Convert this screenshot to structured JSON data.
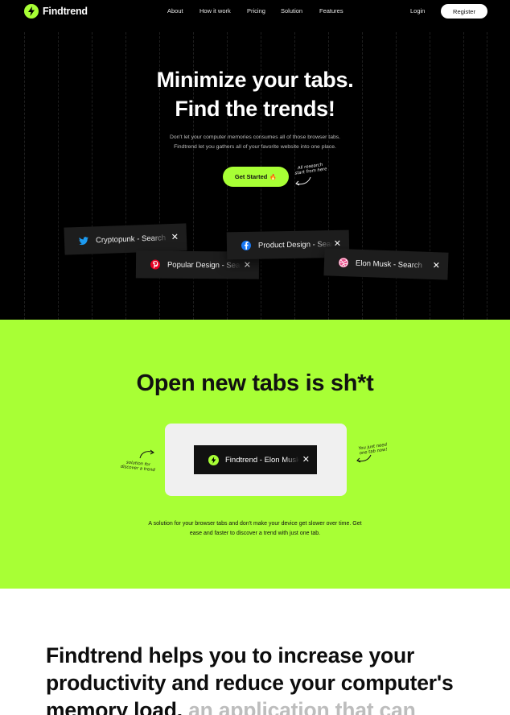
{
  "brand": {
    "name": "Findtrend",
    "accent": "#a8ff35"
  },
  "nav": {
    "links": [
      "About",
      "How it work",
      "Pricing",
      "Solution",
      "Features"
    ],
    "login": "Login",
    "register": "Register"
  },
  "hero": {
    "title_line1": "Minimize your tabs.",
    "title_line2": "Find the trends!",
    "subtitle_line1": "Don't let your computer memories consumes all of those browser tabs.",
    "subtitle_line2": "Findtrend  let you gathers all of your favorite website into one place.",
    "cta_label": "Get Started",
    "cta_emoji": "🔥",
    "note_line1": "All research",
    "note_line2": "start from here",
    "tabs": [
      {
        "icon": "twitter-icon",
        "color": "#1d9bf0",
        "title": "Cryptopunk - Search"
      },
      {
        "icon": "pinterest-icon",
        "color": "#e60023",
        "title": "Popular Design - Search"
      },
      {
        "icon": "facebook-icon",
        "color": "#1877f2",
        "title": "Product Design - Search"
      },
      {
        "icon": "dribbble-icon",
        "color": "#ea4c89",
        "title": "Elon Musk - Search"
      }
    ],
    "close_glyph": "✕"
  },
  "section2": {
    "title": "Open new tabs is sh*t",
    "tab_title": "Findtrend - Elon Musk",
    "note_left_line1": "solution for",
    "note_left_line2": "discover a trend",
    "note_right_line1": "You just need",
    "note_right_line2": "one tab now!",
    "desc_line1": "A solution for your browser tabs and don't make your device get slower over time. Get",
    "desc_line2": "ease and faster to discover a trend with just one tab."
  },
  "section3": {
    "headline": "Findtrend helps you to increase your productivity and reduce your computer's memory load.",
    "headline_faded": "an application that can"
  }
}
